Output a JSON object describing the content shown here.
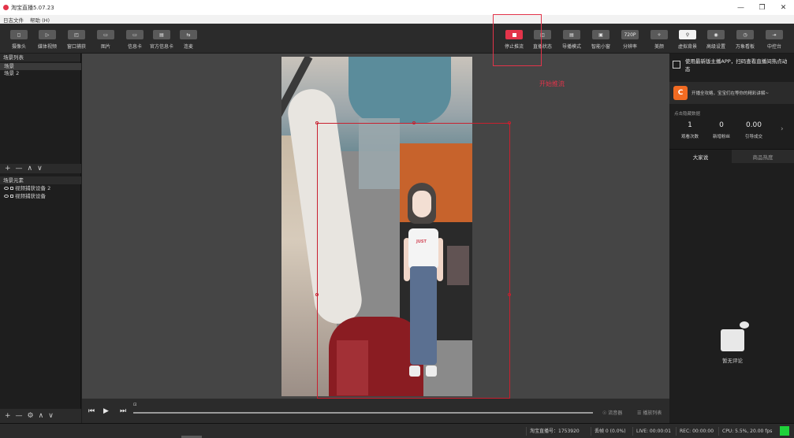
{
  "window": {
    "title": "淘宝直播5.07.23",
    "controls": [
      "—",
      "❐",
      "✕"
    ]
  },
  "menu": {
    "items": [
      "日志文件",
      "帮助 (H)"
    ]
  },
  "toolbar": {
    "left": [
      {
        "label": "摄像头",
        "icon": "camera-icon"
      },
      {
        "label": "媒体视频",
        "icon": "media-video-icon"
      },
      {
        "label": "窗口捕获",
        "icon": "window-capture-icon"
      },
      {
        "label": "图片",
        "icon": "image-icon"
      },
      {
        "label": "信息卡",
        "icon": "info-card-icon"
      },
      {
        "label": "官方信息卡",
        "icon": "official-card-icon"
      },
      {
        "label": "连麦",
        "icon": "co-host-icon"
      }
    ],
    "right": [
      {
        "label": "停止推流",
        "icon": "stop-stream-icon"
      },
      {
        "label": "直播状态",
        "icon": "live-status-icon"
      },
      {
        "label": "导播模式",
        "icon": "director-mode-icon"
      },
      {
        "label": "智能小窗",
        "icon": "smart-window-icon"
      },
      {
        "label": "分辨率",
        "icon": "resolution-icon",
        "badge": "720P"
      },
      {
        "label": "美颜",
        "icon": "beauty-icon"
      },
      {
        "label": "虚拟背景",
        "icon": "search-icon"
      },
      {
        "label": "高级设置",
        "icon": "settings-icon"
      },
      {
        "label": "万象看板",
        "icon": "dashboard-icon"
      },
      {
        "label": "中控台",
        "icon": "console-icon"
      }
    ],
    "annotation": "开始推流"
  },
  "scenes": {
    "header": "场景列表",
    "items": [
      "场景",
      "场景 2"
    ],
    "tools": [
      "+",
      "—",
      "∧",
      "∨"
    ]
  },
  "elements": {
    "header": "场景元素",
    "items": [
      "视频捕获设备 2",
      "视频捕获设备"
    ],
    "tools": [
      "+",
      "—",
      "⚙",
      "∧",
      "∨"
    ]
  },
  "transport": {
    "marker": "⊡",
    "playlist_link_1": "☉ 流音器",
    "playlist_link_2": "☰ 播放列表"
  },
  "right_panel": {
    "banner": "使用最新版主播APP，扫码查看直播间热点动态",
    "promo": "开播全攻略，宝宝们在等你的精彩讲解~",
    "stats_header": "点击隐藏数据",
    "stats": [
      {
        "value": "1",
        "label": "观看次数"
      },
      {
        "value": "0",
        "label": "新增粉丝"
      },
      {
        "value": "0.00",
        "label": "引导成交"
      }
    ],
    "tabs": [
      "大家说",
      "商品热度"
    ],
    "empty_text": "暂无评论"
  },
  "status": {
    "room": "淘宝直播号：1753920",
    "dropped": "丢帧 0 (0.0%)",
    "live": "LIVE: 00:00:01",
    "rec": "REC: 00:00:00",
    "cpu": "CPU: 5.5%, 20.00 fps",
    "indicator_color": "#1fd13a"
  },
  "colors": {
    "accent": "#e3344a",
    "brand_orange": "#f26b22"
  }
}
